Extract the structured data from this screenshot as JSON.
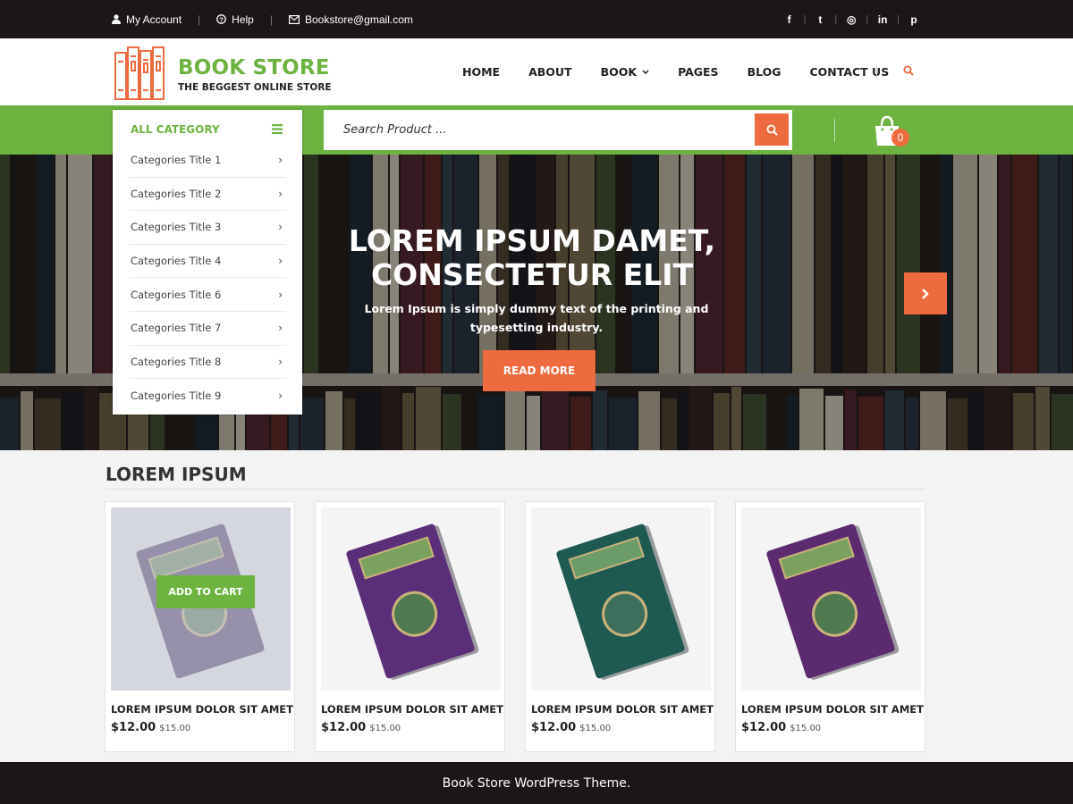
{
  "topbar": {
    "account_label": "My Account",
    "help_label": "Help",
    "email_label": "Bookstore@gmail.com",
    "social": [
      "facebook-icon",
      "twitter-icon",
      "instagram-icon",
      "linkedin-icon",
      "pinterest-icon"
    ],
    "social_glyphs": [
      "f",
      "t",
      "◎",
      "in",
      "p"
    ]
  },
  "header": {
    "brand": "BOOK STORE",
    "tagline": "THE BEGGEST ONLINE STORE",
    "nav": {
      "home": "HOME",
      "about": "ABOUT",
      "book": "BOOK",
      "pages": "PAGES",
      "blog": "BLOG",
      "contact": "CONTACT US"
    }
  },
  "search": {
    "placeholder": "Search Product ..."
  },
  "cart": {
    "count": "0"
  },
  "categories": {
    "heading": "ALL CATEGORY",
    "items": [
      "Categories Title 1",
      "Categories Title 2",
      "Categories Title 3",
      "Categories Title 4",
      "Categories Title 6",
      "Categories Title 7",
      "Categories Title 8",
      "Categories Title 9"
    ]
  },
  "hero": {
    "title_line1": "LOREM IPSUM DAMET,",
    "title_line2": "CONSECTETUR  ELIT",
    "text_line1": "Lorem Ipsum is simply dummy text of the printing and",
    "text_line2": "typesetting industry.",
    "button": "READ MORE"
  },
  "products_section": {
    "title": "LOREM IPSUM",
    "add_to_cart": "ADD TO CART",
    "items": [
      {
        "title": "LOREM IPSUM DOLOR SIT AMET",
        "price": "$12.00",
        "old_price": "$15.00"
      },
      {
        "title": "LOREM IPSUM DOLOR SIT AMET",
        "price": "$12.00",
        "old_price": "$15.00"
      },
      {
        "title": "LOREM IPSUM DOLOR SIT AMET",
        "price": "$12.00",
        "old_price": "$15.00"
      },
      {
        "title": "LOREM IPSUM DOLOR SIT AMET",
        "price": "$12.00",
        "old_price": "$15.00"
      }
    ]
  },
  "colors": {
    "brand_green": "#6db33f",
    "accent_orange": "#ee6a3f",
    "dark": "#1c1716"
  },
  "footer": {
    "text": "Book Store WordPress Theme."
  }
}
